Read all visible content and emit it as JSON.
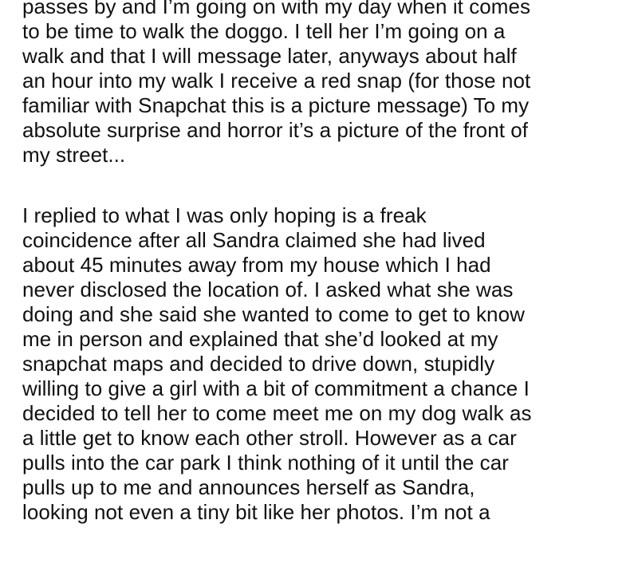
{
  "post": {
    "paragraphs": [
      {
        "lines": [
          "passes by and I’m going on with my day when it comes",
          "to be time to walk the doggo. I tell her I’m going on a",
          "walk and that I will message later, anyways about half",
          "an hour into my walk I receive a red snap (for those not",
          "familiar with Snapchat this is a picture message) To my",
          "absolute surprise and horror it’s a picture of the front of",
          "my street..."
        ]
      },
      {
        "lines": [
          "I replied to what I was only hoping is a freak",
          "coincidence after all Sandra claimed she had lived",
          "about 45 minutes away from my house which I had",
          "never disclosed the location of. I asked what she was",
          "doing and she said she wanted to come to get to know",
          "me in person and explained that she’d looked at my",
          "snapchat maps and decided to drive down, stupidly",
          "willing to give a girl with a bit of commitment a chance I",
          "decided to tell her to come meet me on my dog walk as",
          "a little get to know each other stroll. However as a car",
          "pulls into the car park I think nothing of it until the car",
          "pulls up to me and announces herself as Sandra,",
          "looking not even a tiny bit like her photos. I’m not a"
        ]
      }
    ]
  }
}
